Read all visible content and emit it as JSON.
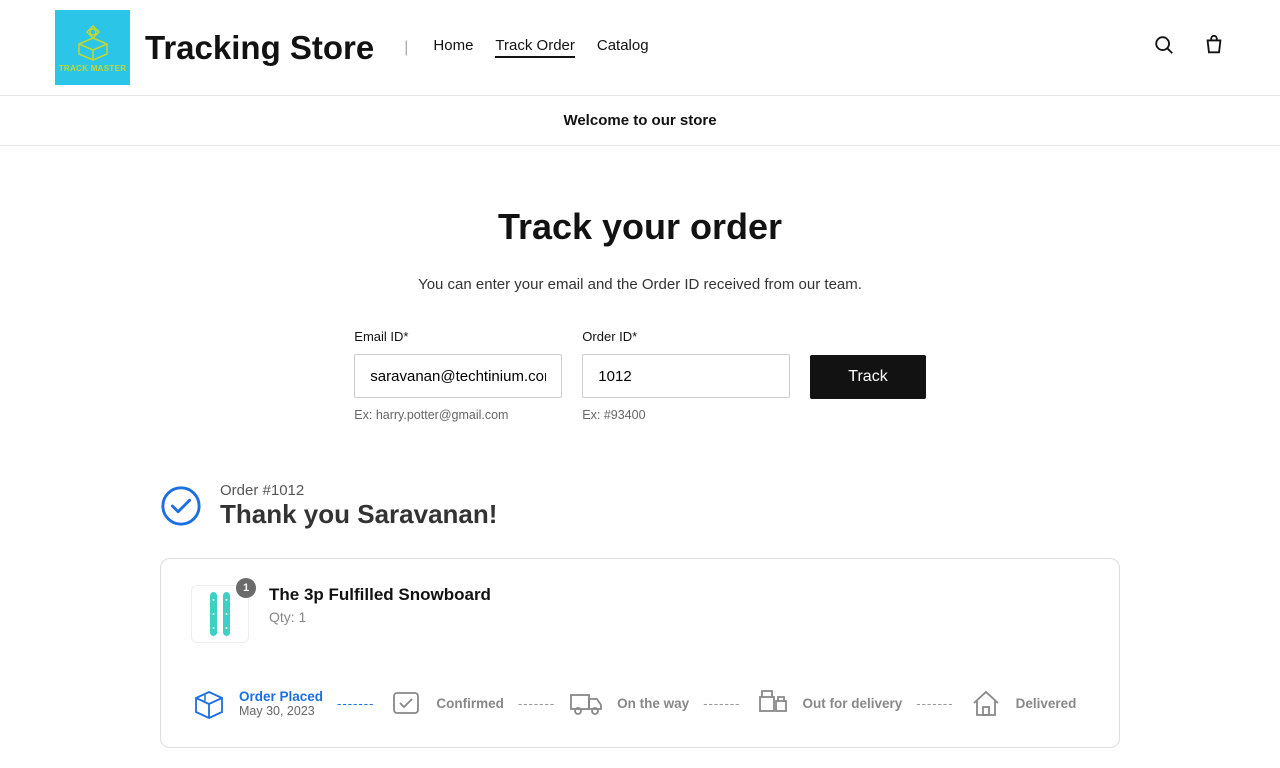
{
  "header": {
    "logo_text": "TRACK MASTER",
    "store_name": "Tracking Store",
    "nav": [
      {
        "label": "Home",
        "active": false
      },
      {
        "label": "Track Order",
        "active": true
      },
      {
        "label": "Catalog",
        "active": false
      }
    ]
  },
  "banner": "Welcome to our store",
  "page": {
    "title": "Track your order",
    "subtitle": "You can enter your email and the Order ID received from our team."
  },
  "form": {
    "email_label": "Email ID*",
    "email_value": "saravanan@techtinium.com",
    "email_hint": "Ex: harry.potter@gmail.com",
    "order_label": "Order ID*",
    "order_value": "1012",
    "order_hint": "Ex: #93400",
    "track_button": "Track"
  },
  "result": {
    "order_id_line": "Order #1012",
    "thank_you": "Thank you Saravanan!",
    "product": {
      "name": "The 3p Fulfilled Snowboard",
      "qty_line": "Qty: 1",
      "badge": "1"
    },
    "steps": [
      {
        "label": "Order Placed",
        "date": "May 30, 2023",
        "active": true
      },
      {
        "label": "Confirmed",
        "date": "",
        "active": false
      },
      {
        "label": "On the way",
        "date": "",
        "active": false
      },
      {
        "label": "Out for delivery",
        "date": "",
        "active": false
      },
      {
        "label": "Delivered",
        "date": "",
        "active": false
      }
    ]
  }
}
